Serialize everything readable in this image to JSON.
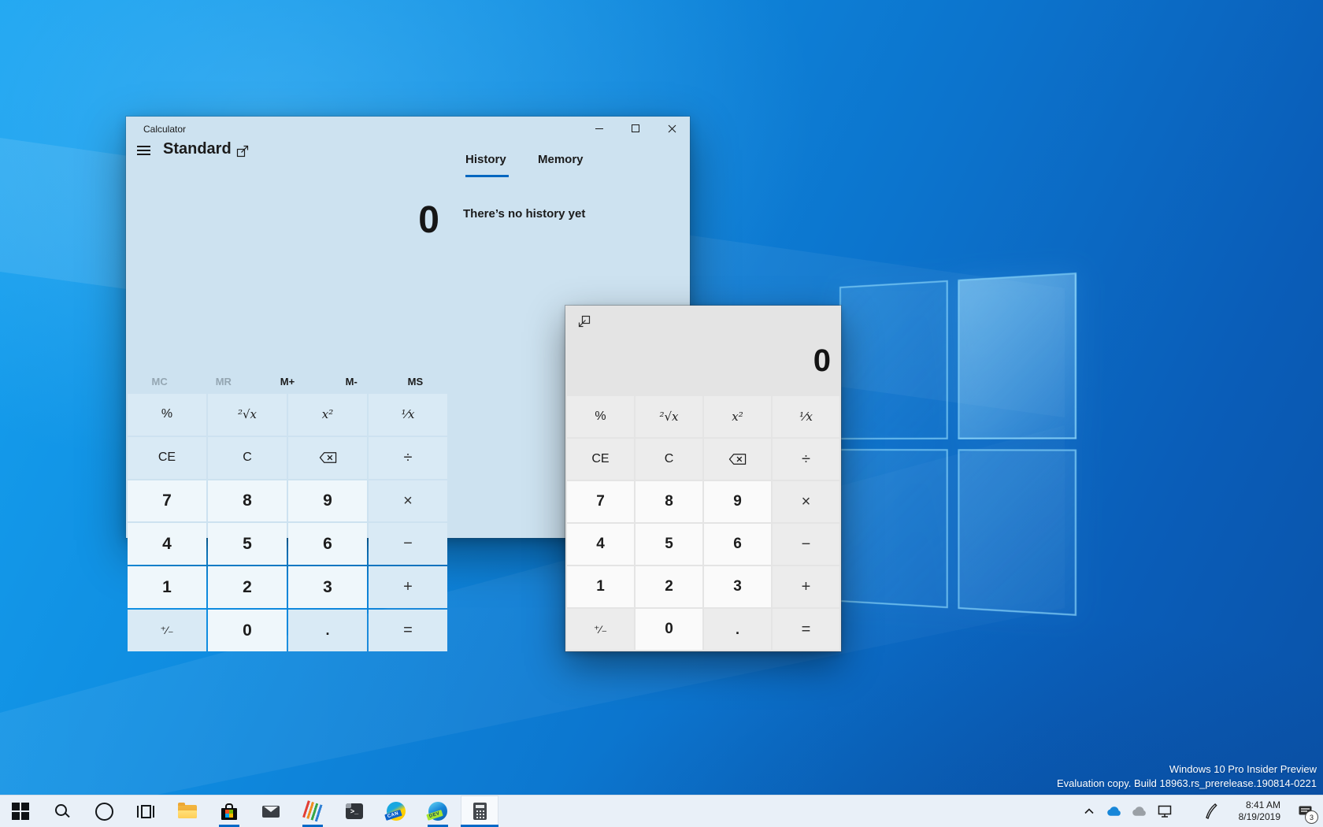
{
  "desktop": {
    "watermark_line1": "Windows 10 Pro Insider Preview",
    "watermark_line2": "Evaluation copy. Build 18963.rs_prerelease.190814-0221"
  },
  "main_calculator": {
    "window_title": "Calculator",
    "mode_label": "Standard",
    "display_value": "0",
    "tab_history": "History",
    "tab_memory": "Memory",
    "active_tab": "History",
    "history_empty_text": "There’s no history yet",
    "memory_keys": [
      {
        "id": "memory-clear",
        "label": "MC",
        "enabled": false
      },
      {
        "id": "memory-recall",
        "label": "MR",
        "enabled": false
      },
      {
        "id": "memory-add",
        "label": "M+",
        "enabled": true
      },
      {
        "id": "memory-subtract",
        "label": "M-",
        "enabled": true
      },
      {
        "id": "memory-store",
        "label": "MS",
        "enabled": true
      }
    ]
  },
  "compact_calculator": {
    "display_value": "0"
  },
  "keypad": [
    {
      "id": "percent",
      "label": "%",
      "type": "fn"
    },
    {
      "id": "square-root",
      "label": "²√x",
      "type": "fn"
    },
    {
      "id": "square",
      "label": "x²",
      "type": "fn"
    },
    {
      "id": "reciprocal",
      "label": "⅟x",
      "type": "fn"
    },
    {
      "id": "clear-entry",
      "label": "CE",
      "type": "fn"
    },
    {
      "id": "clear",
      "label": "C",
      "type": "fn"
    },
    {
      "id": "backspace",
      "label": "⌫",
      "type": "fn"
    },
    {
      "id": "divide",
      "label": "÷",
      "type": "fn"
    },
    {
      "id": "seven",
      "label": "7",
      "type": "num"
    },
    {
      "id": "eight",
      "label": "8",
      "type": "num"
    },
    {
      "id": "nine",
      "label": "9",
      "type": "num"
    },
    {
      "id": "multiply",
      "label": "×",
      "type": "fn"
    },
    {
      "id": "four",
      "label": "4",
      "type": "num"
    },
    {
      "id": "five",
      "label": "5",
      "type": "num"
    },
    {
      "id": "six",
      "label": "6",
      "type": "num"
    },
    {
      "id": "subtract",
      "label": "−",
      "type": "fn"
    },
    {
      "id": "one",
      "label": "1",
      "type": "num"
    },
    {
      "id": "two",
      "label": "2",
      "type": "num"
    },
    {
      "id": "three",
      "label": "3",
      "type": "num"
    },
    {
      "id": "add",
      "label": "+",
      "type": "fn"
    },
    {
      "id": "negate",
      "label": "⁺⁄₋",
      "type": "fn"
    },
    {
      "id": "zero",
      "label": "0",
      "type": "num"
    },
    {
      "id": "decimal",
      "label": ".",
      "type": "fn"
    },
    {
      "id": "equals",
      "label": "=",
      "type": "fn"
    }
  ],
  "taskbar": {
    "items": [
      {
        "id": "start",
        "icon": "windows-logo"
      },
      {
        "id": "search",
        "icon": "search"
      },
      {
        "id": "cortana",
        "icon": "cortana"
      },
      {
        "id": "task-view",
        "icon": "task-view"
      },
      {
        "id": "file-explorer",
        "icon": "folder"
      },
      {
        "id": "microsoft-store",
        "icon": "store",
        "running": true
      },
      {
        "id": "mail",
        "icon": "mail"
      },
      {
        "id": "striped-app",
        "icon": "stripes",
        "running": true
      },
      {
        "id": "terminal",
        "icon": "terminal"
      },
      {
        "id": "edge-canary",
        "icon": "edge-canary",
        "badge": "CAN"
      },
      {
        "id": "edge-dev",
        "icon": "edge-dev",
        "badge": "DEV",
        "running": true
      },
      {
        "id": "calculator",
        "icon": "calculator",
        "running": true,
        "active": true
      }
    ],
    "tray": {
      "clock_time": "8:41 AM",
      "clock_date": "8/19/2019",
      "notification_count": "3"
    }
  }
}
